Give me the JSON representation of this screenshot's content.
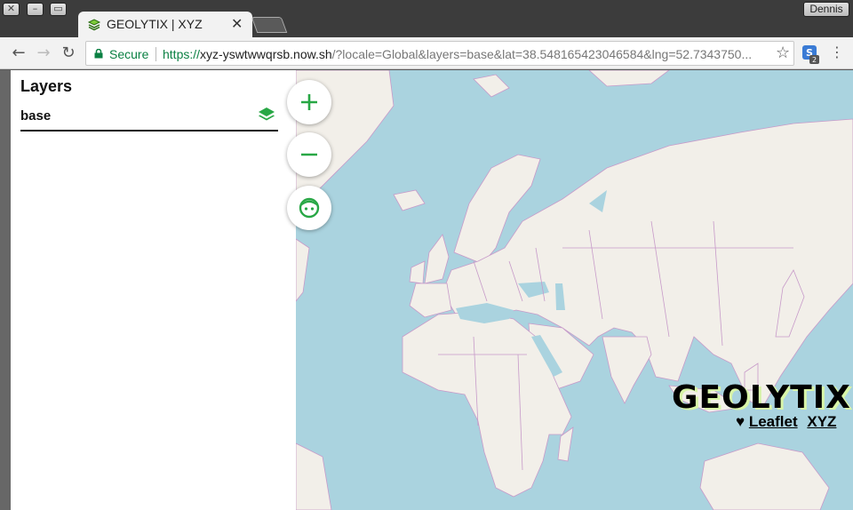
{
  "window": {
    "user_name": "Dennis"
  },
  "tab": {
    "title": "GEOLYTIX | XYZ"
  },
  "toolbar": {
    "secure_label": "Secure",
    "url_scheme": "https://",
    "url_host": "xyz-yswtwwqrsb.now.sh",
    "url_rest": "/?locale=Global&layers=base&lat=38.548165423046584&lng=52.7343750...",
    "extension_badge": "2"
  },
  "panel": {
    "title": "Layers",
    "layers": [
      {
        "name": "base"
      }
    ]
  },
  "map": {
    "brand": "GEOLYTIX",
    "attribution_heart": "♥",
    "attribution_leaflet": "Leaflet",
    "attribution_xyz": "XYZ",
    "colors": {
      "water": "#aad3df",
      "land": "#f2efe9",
      "borders": "#c79ac9",
      "accent": "#28a745"
    }
  }
}
